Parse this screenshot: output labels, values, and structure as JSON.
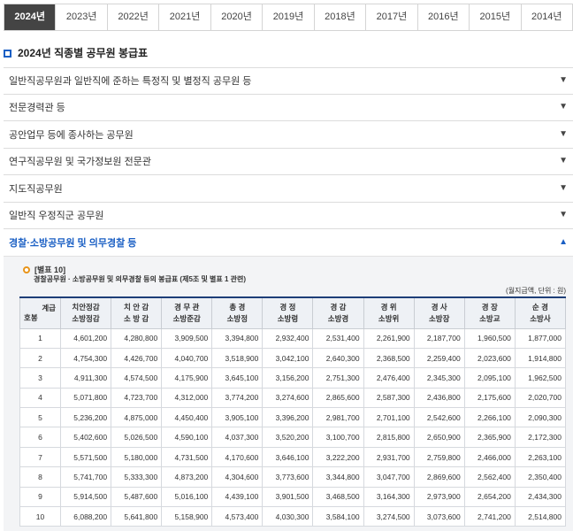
{
  "year_tabs": [
    "2024년",
    "2023년",
    "2022년",
    "2021년",
    "2020년",
    "2019년",
    "2018년",
    "2017년",
    "2016년",
    "2015년",
    "2014년"
  ],
  "active_year_index": 0,
  "page_title": "2024년 직종별 공무원 봉급표",
  "accordion": [
    {
      "label": "일반직공무원과 일반직에 준하는 특정직 및 별정직 공무원 등",
      "arrow": "▼"
    },
    {
      "label": "전문경력관 등",
      "arrow": "▼"
    },
    {
      "label": "공안업무 등에 종사하는 공무원",
      "arrow": "▼"
    },
    {
      "label": "연구직공무원 및 국가정보원 전문관",
      "arrow": "▼"
    },
    {
      "label": "지도직공무원",
      "arrow": "▼"
    },
    {
      "label": "일반직 우정직군 공무원",
      "arrow": "▼"
    },
    {
      "label": "경찰·소방공무원 및 의무경찰 등",
      "arrow": "▲"
    }
  ],
  "panel": {
    "note_title": "[별표 10]",
    "note_sub": "경찰공무원 · 소방공무원 및 의무경찰 등의 봉급표 (제5조 및 별표 1 관련)",
    "unit": "(월지급액, 단위 : 원)",
    "corner_top": "계급",
    "corner_bottom": "호봉",
    "headers": [
      [
        "치안정감",
        "소방정감"
      ],
      [
        "치 안 감",
        "소 방 감"
      ],
      [
        "경 무 관",
        "소방준감"
      ],
      [
        "총 경",
        "소방정"
      ],
      [
        "경 정",
        "소방령"
      ],
      [
        "경 감",
        "소방경"
      ],
      [
        "경 위",
        "소방위"
      ],
      [
        "경 사",
        "소방장"
      ],
      [
        "경 장",
        "소방교"
      ],
      [
        "순 경",
        "소방사"
      ]
    ],
    "rows": [
      {
        "step": "1",
        "values": [
          "4,601,200",
          "4,280,800",
          "3,909,500",
          "3,394,800",
          "2,932,400",
          "2,531,400",
          "2,261,900",
          "2,187,700",
          "1,960,500",
          "1,877,000"
        ]
      },
      {
        "step": "2",
        "values": [
          "4,754,300",
          "4,426,700",
          "4,040,700",
          "3,518,900",
          "3,042,100",
          "2,640,300",
          "2,368,500",
          "2,259,400",
          "2,023,600",
          "1,914,800"
        ]
      },
      {
        "step": "3",
        "values": [
          "4,911,300",
          "4,574,500",
          "4,175,900",
          "3,645,100",
          "3,156,200",
          "2,751,300",
          "2,476,400",
          "2,345,300",
          "2,095,100",
          "1,962,500"
        ]
      },
      {
        "step": "4",
        "values": [
          "5,071,800",
          "4,723,700",
          "4,312,000",
          "3,774,200",
          "3,274,600",
          "2,865,600",
          "2,587,300",
          "2,436,800",
          "2,175,600",
          "2,020,700"
        ]
      },
      {
        "step": "5",
        "values": [
          "5,236,200",
          "4,875,000",
          "4,450,400",
          "3,905,100",
          "3,396,200",
          "2,981,700",
          "2,701,100",
          "2,542,600",
          "2,266,100",
          "2,090,300"
        ]
      },
      {
        "step": "6",
        "values": [
          "5,402,600",
          "5,026,500",
          "4,590,100",
          "4,037,300",
          "3,520,200",
          "3,100,700",
          "2,815,800",
          "2,650,900",
          "2,365,900",
          "2,172,300"
        ]
      },
      {
        "step": "7",
        "values": [
          "5,571,500",
          "5,180,000",
          "4,731,500",
          "4,170,600",
          "3,646,100",
          "3,222,200",
          "2,931,700",
          "2,759,800",
          "2,466,000",
          "2,263,100"
        ]
      },
      {
        "step": "8",
        "values": [
          "5,741,700",
          "5,333,300",
          "4,873,200",
          "4,304,600",
          "3,773,600",
          "3,344,800",
          "3,047,700",
          "2,869,600",
          "2,562,400",
          "2,350,400"
        ]
      },
      {
        "step": "9",
        "values": [
          "5,914,500",
          "5,487,600",
          "5,016,100",
          "4,439,100",
          "3,901,500",
          "3,468,500",
          "3,164,300",
          "2,973,900",
          "2,654,200",
          "2,434,300"
        ]
      },
      {
        "step": "10",
        "values": [
          "6,088,200",
          "5,641,800",
          "5,158,900",
          "4,573,400",
          "4,030,300",
          "3,584,100",
          "3,274,500",
          "3,073,600",
          "2,741,200",
          "2,514,800"
        ]
      }
    ]
  }
}
